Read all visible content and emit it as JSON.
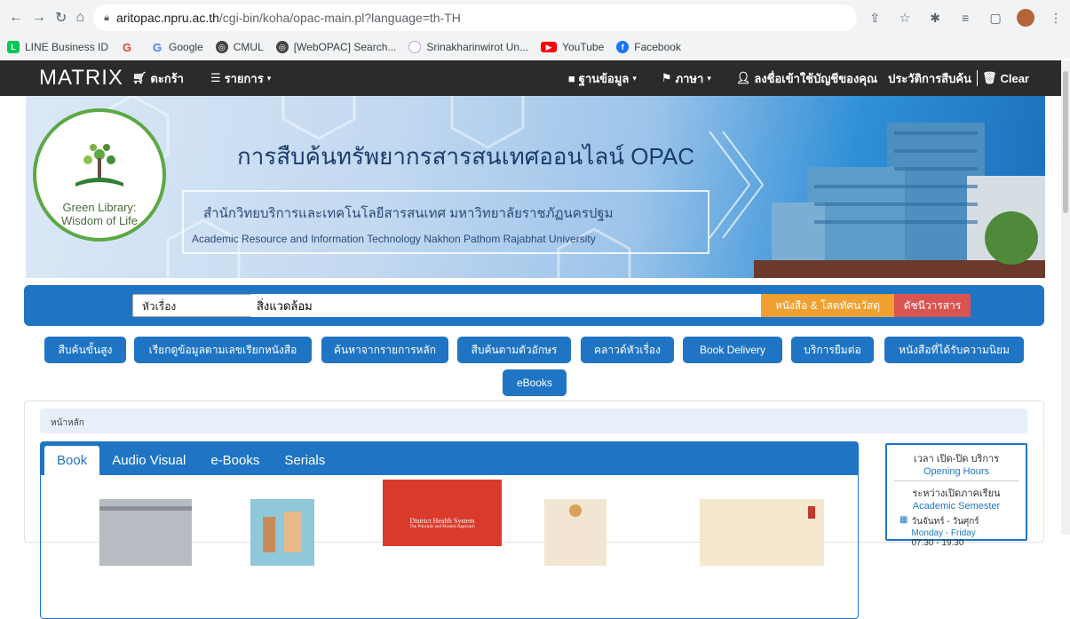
{
  "browser": {
    "url_host": "aritopac.npru.ac.th",
    "url_path": "/cgi-bin/koha/opac-main.pl?language=th-TH",
    "bookmarks": [
      {
        "label": "LINE Business ID",
        "icon": "line-icon",
        "color": "#06c755"
      },
      {
        "label": "",
        "icon": "google-g-icon",
        "color": "#ea4335"
      },
      {
        "label": "Google",
        "icon": "google-g-icon",
        "color": "#4285f4"
      },
      {
        "label": "CMUL",
        "icon": "globe-icon",
        "color": "#444444"
      },
      {
        "label": "[WebOPAC] Search...",
        "icon": "globe-icon",
        "color": "#444444"
      },
      {
        "label": "Srinakharinwirot Un...",
        "icon": "university-icon",
        "color": "#c0a0d0"
      },
      {
        "label": "YouTube",
        "icon": "youtube-icon",
        "color": "#ff0000"
      },
      {
        "label": "Facebook",
        "icon": "facebook-icon",
        "color": "#1877f2"
      }
    ]
  },
  "navbar": {
    "brand": "MATRIX",
    "cart": "ตะกร้า",
    "lists": "รายการ",
    "database": "ฐานข้อมูล",
    "language": "ภาษา",
    "login": "ลงชื่อเข้าใช้บัญชีของคุณ",
    "history": "ประวัติการสืบค้น",
    "clear": "Clear"
  },
  "banner": {
    "logo_line1": "Green Library:",
    "logo_line2": "Wisdom of Life",
    "title": "การสืบค้นทรัพยากรสารสนเทศออนไลน์ OPAC",
    "subtitle_th": "สำนักวิทยบริการและเทคโนโลยีสารสนเทศ มหาวิทยาลัยราชภัฏนครปฐม",
    "subtitle_en": "Academic Resource and Information Technology  Nakhon Pathom Rajabhat University"
  },
  "search": {
    "index_selected": "หัวเรื่อง",
    "query": "สิ่งแวดล้อม",
    "books_button": "หนังสือ & โสตทัศนวัสดุ",
    "index_button": "ดัชนีวารสาร"
  },
  "quick_links": [
    "สืบค้นขั้นสูง",
    "เรียกดูข้อมูลตามเลขเรียกหนังสือ",
    "ค้นหาจากรายการหลัก",
    "สืบค้นตามตัวอักษร",
    "คลาวด์หัวเรื่อง",
    "Book Delivery",
    "บริการยืมต่อ",
    "หนังสือที่ได้รับความนิยม",
    "eBooks"
  ],
  "breadcrumb": "หน้าหลัก",
  "tabs": [
    "Book",
    "Audio Visual",
    "e-Books",
    "Serials"
  ],
  "book_covers": [
    {
      "title": "",
      "subtitle": "",
      "color": "#b7bcc2"
    },
    {
      "title": "",
      "subtitle": "",
      "color": "#8fc8d8"
    },
    {
      "title": "District Health System",
      "subtitle": "The Principle and Modern Approach",
      "color": "#d93a2b"
    },
    {
      "title": "",
      "subtitle": "",
      "color": "#f2e6d2"
    },
    {
      "title": "",
      "subtitle": "",
      "color": "#f4e8cf"
    }
  ],
  "hours": {
    "title_th": "เวลา เปิด-ปิด บริการ",
    "title_en": "Opening Hours",
    "term_th": "ระหว่างเปิดภาคเรียน",
    "term_en": "Academic Semester",
    "days_th": "วันจันทร์ - วันศุกร์",
    "days_en": "Monday - Friday",
    "time": "07.30 - 19.30"
  }
}
